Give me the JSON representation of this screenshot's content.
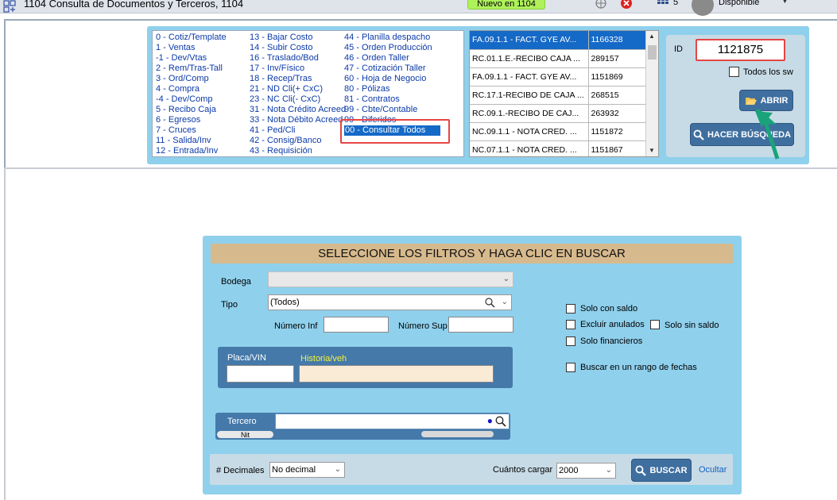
{
  "titlebar": {
    "title": "1104 Consulta de Documentos y Terceros, 1104",
    "new_button": "Nuevo en 1104",
    "badge_count": "5",
    "status": "Disponible"
  },
  "doc_types": {
    "col1": [
      "0 - Cotiz/Template",
      "1 - Ventas",
      "-1 - Dev/Vtas",
      "2 - Rem/Tras-Tall",
      "3 - Ord/Comp",
      "4 - Compra",
      "-4 - Dev/Comp",
      "5 - Recibo Caja",
      "6 - Egresos",
      "7 - Cruces",
      "11 - Salida/Inv",
      "12 - Entrada/Inv"
    ],
    "col2": [
      "13 - Bajar Costo",
      "14 - Subir Costo",
      "16 - Traslado/Bod",
      "17 - Inv/Físico",
      "18 - Recep/Tras",
      "21 - ND Cli(+ CxC)",
      "23 - NC Cli(- CxC)",
      "31 - Nota Crédito Acreed",
      "33 - Nota Débito Acreed",
      "41 - Ped/Cli",
      "42 - Consig/Banco",
      "43 - Requisición"
    ],
    "col3": [
      "44 - Planilla despacho",
      "45 - Orden Producción",
      "46 - Orden Taller",
      "47 - Cotización Taller",
      "60 - Hoja de Negocio",
      "80 - Pólizas",
      "81 - Contratos",
      "99 - Cbte/Contable",
      "99 - Diferidos",
      "00 - Consultar Todos"
    ]
  },
  "results": [
    {
      "doc": "FA.09.1.1 - FACT. GYE AV...",
      "num": "1166328"
    },
    {
      "doc": "RC.01.1.E.-RECIBO CAJA ...",
      "num": "289157"
    },
    {
      "doc": "FA.09.1.1 - FACT. GYE AV...",
      "num": "1151869"
    },
    {
      "doc": "RC.17.1-RECIBO DE CAJA ...",
      "num": "268515"
    },
    {
      "doc": "RC.09.1.-RECIBO DE CAJ...",
      "num": "263932"
    },
    {
      "doc": "NC.09.1.1 - NOTA CRED. ...",
      "num": "1151872"
    },
    {
      "doc": "NC.07.1.1 - NOTA CRED. ...",
      "num": "1151867"
    }
  ],
  "id_panel": {
    "label": "ID",
    "value": "1121875",
    "todos_label": "Todos los sw",
    "abrir": "ABRIR",
    "hacer_busqueda": "HACER BÚSQUEDA"
  },
  "filters": {
    "header": "SELECCIONE LOS FILTROS Y HAGA CLIC EN BUSCAR",
    "bodega_label": "Bodega",
    "tipo_label": "Tipo",
    "tipo_value": "(Todos)",
    "num_inf_label": "Número Inf",
    "num_sup_label": "Número Sup",
    "placa_label": "Placa/VIN",
    "historia_label": "Historia/veh",
    "tercero_label": "Tercero",
    "nit_label": "Nit",
    "solo_con_saldo": "Solo con saldo",
    "excluir_anulados": "Excluir anulados",
    "solo_sin_saldo": "Solo sin saldo",
    "solo_financieros": "Solo financieros",
    "rango_fechas": "Buscar en un rango de fechas",
    "decimales_label": "# Decimales",
    "decimales_value": "No decimal",
    "cuantos_label": "Cuántos cargar",
    "cuantos_value": "2000",
    "buscar": "BUSCAR",
    "ocultar": "Ocultar"
  },
  "colors": {
    "panel": "#8fd0ec",
    "selection": "#1569c7",
    "button": "#3f6f9f",
    "highlight": "#e64545",
    "header": "#d6b98d"
  }
}
